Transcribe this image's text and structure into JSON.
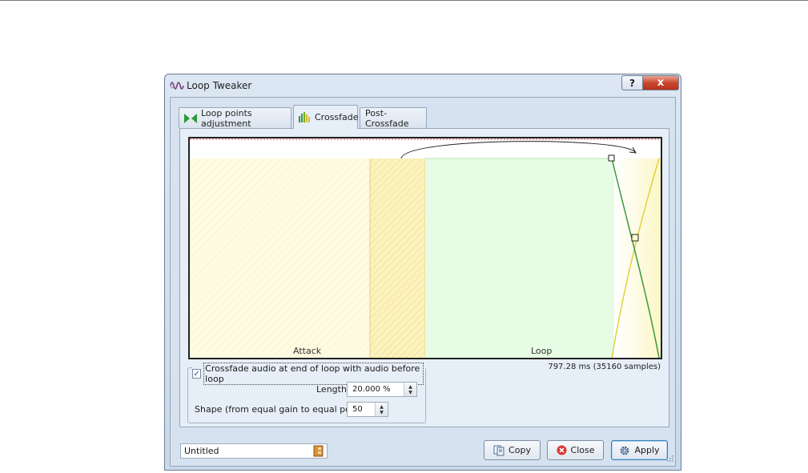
{
  "window": {
    "title": "Loop Tweaker",
    "help_label": "?",
    "close_label": "x"
  },
  "tabs": [
    {
      "label": "Loop points adjustment",
      "icon": "loop-points-icon",
      "active": false
    },
    {
      "label": "Crossfade",
      "icon": "crossfade-icon",
      "active": true
    },
    {
      "label": "Post-Crossfade",
      "icon": "",
      "active": false
    }
  ],
  "graph": {
    "attack_label": "Attack",
    "loop_label": "Loop",
    "colors": {
      "attack": "#fffbe0",
      "crossfade": "#fbf0b6",
      "loop": "#e6fbe3",
      "fade_out": "#3a9a3a",
      "fade_in": "#e6cf3a"
    }
  },
  "crossfade": {
    "enabled": true,
    "checkbox_label": "Crossfade audio at end of loop with audio before loop",
    "length_label": "Length",
    "length_value": "20.000 %",
    "shape_label": "Shape (from equal gain to equal power)",
    "shape_value": "50",
    "duration_text": "797.28 ms (35160 samples)"
  },
  "footer": {
    "preset_name": "Untitled",
    "copy_label": "Copy",
    "close_label": "Close",
    "apply_label": "Apply"
  }
}
